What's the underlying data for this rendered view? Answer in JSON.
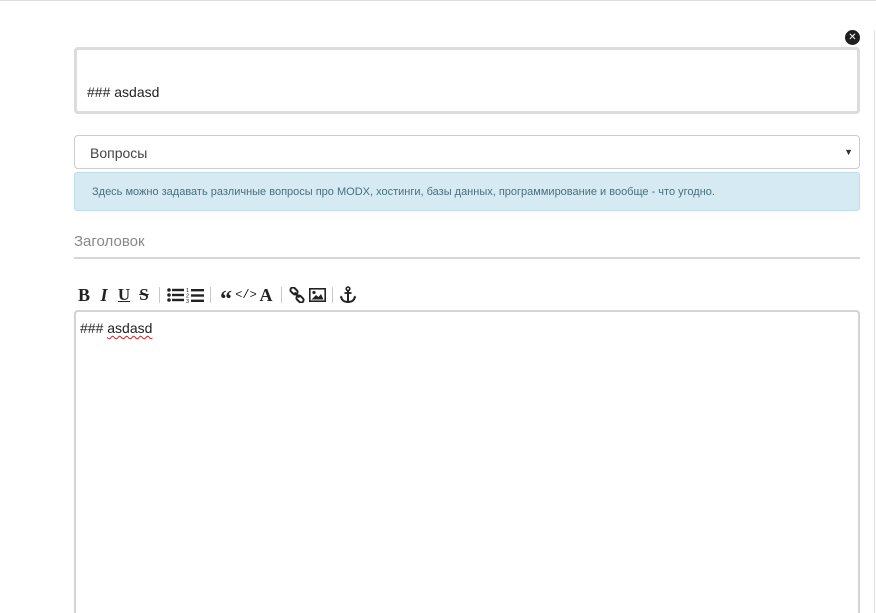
{
  "preview": {
    "text": "### asdasd"
  },
  "category_select": {
    "selected": "Вопросы"
  },
  "info": {
    "text": "Здесь можно задавать различные вопросы про MODX, хостинги, базы данных, программирование и вообще - что угодно."
  },
  "title_field": {
    "placeholder": "Заголовок",
    "value": ""
  },
  "editor": {
    "prefix": "### ",
    "word": "asdasd"
  },
  "toolbar": {
    "buttons": [
      {
        "name": "bold",
        "glyph": "B"
      },
      {
        "name": "italic",
        "glyph": "I"
      },
      {
        "name": "underline",
        "glyph": "U"
      },
      {
        "name": "strikethrough",
        "glyph": "S"
      },
      {
        "name": "quote",
        "glyph": "“"
      },
      {
        "name": "code",
        "glyph": "</>"
      },
      {
        "name": "font",
        "glyph": "A"
      },
      {
        "name": "anchor",
        "glyph": "⚓"
      }
    ]
  },
  "colors": {
    "info_bg": "#d5eaf2",
    "info_text": "#4b6f7e",
    "misspelling": "#d22020"
  },
  "icons": [
    "close-icon",
    "bullet-list-icon",
    "numbered-list-icon",
    "link-icon",
    "image-icon",
    "anchor-icon"
  ]
}
